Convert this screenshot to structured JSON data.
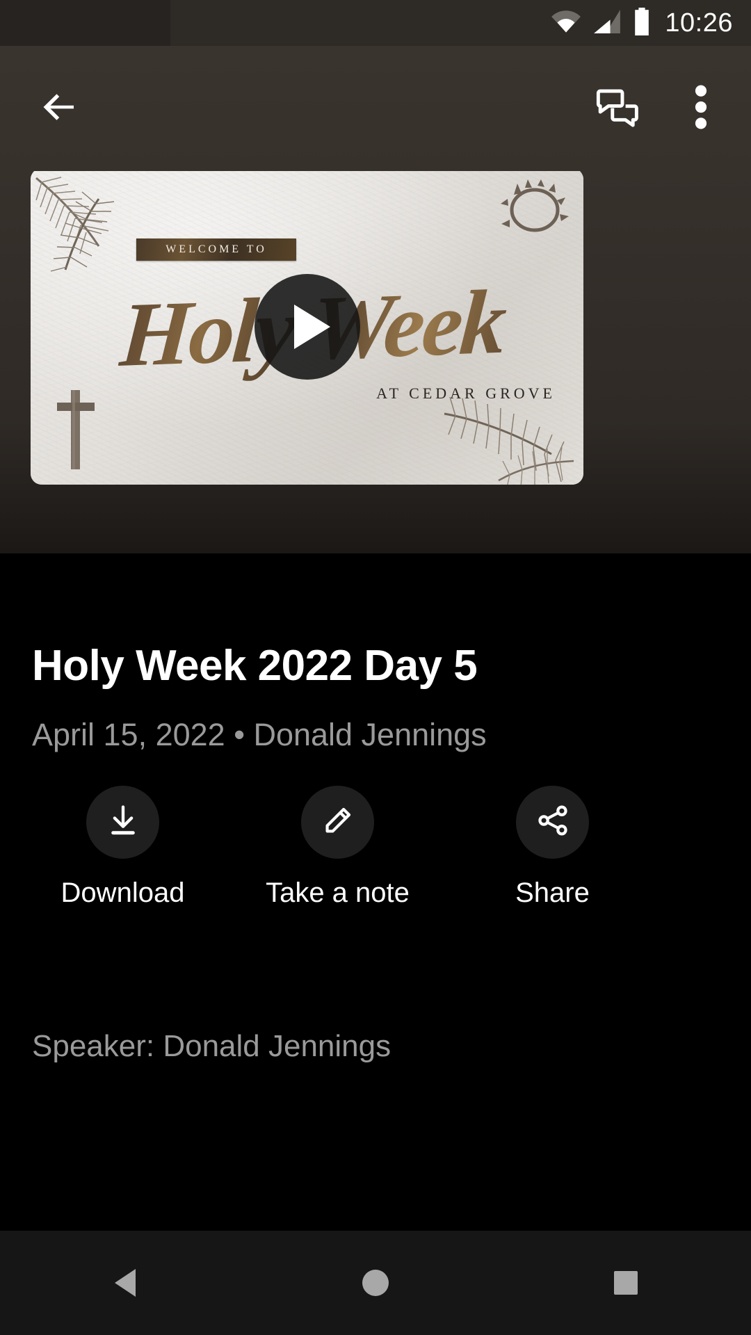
{
  "status_bar": {
    "time": "10:26",
    "icons": [
      "wifi-icon",
      "cellular-signal-icon",
      "battery-icon"
    ]
  },
  "app_bar": {
    "back_icon": "back-arrow-icon",
    "chat_icon": "chat-bubbles-icon",
    "overflow_icon": "more-vert-icon"
  },
  "media": {
    "play_label": "Play",
    "thumbnail": {
      "banner_text": "WELCOME TO",
      "title_script": "Holy Week",
      "footer_text": "AT CEDAR GROVE",
      "decorations": [
        "palm-frond-top-left",
        "crown-of-thorns-top-right",
        "palm-frond-bottom-right",
        "wooden-cross-bottom-left"
      ],
      "accent_color": "#6b5334",
      "background_color": "#e3e0dc"
    }
  },
  "detail": {
    "title": "Holy Week 2022 Day 5",
    "subtitle": "April 15, 2022 • Donald Jennings",
    "speaker_line": "Speaker: Donald Jennings"
  },
  "actions": [
    {
      "label": "Download",
      "icon": "download-icon"
    },
    {
      "label": "Take a note",
      "icon": "pencil-icon"
    },
    {
      "label": "Share",
      "icon": "share-nodes-icon"
    }
  ],
  "nav_bar": {
    "back": "nav-back-icon",
    "home": "nav-home-icon",
    "recents": "nav-recents-icon"
  },
  "colors": {
    "status_bar_bg": "#2e2a26",
    "app_bar_bg": "#37312c",
    "page_bg": "#000000",
    "primary_text": "#ffffff",
    "secondary_text": "#9a9a9a",
    "action_circle_bg": "#1f1f1f",
    "nav_bar_bg": "#161616"
  }
}
